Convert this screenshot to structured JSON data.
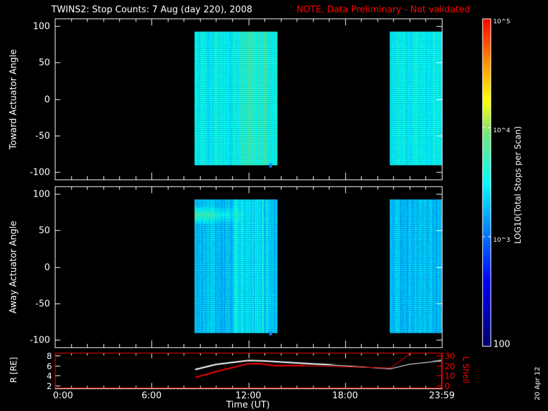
{
  "chart_data": {
    "type": "heatmap",
    "title": "TWINS2: Stop Counts:  7 Aug (day 220), 2008",
    "note": "NOTE. Data Preliminary - Not validated",
    "note_color": "#ff0000",
    "panels": [
      {
        "ylabel": "Toward Actuator Angle",
        "ylim": [
          -110,
          110
        ],
        "yticks": [
          "100",
          "50",
          "0",
          "-50",
          "-100"
        ],
        "ytick_values": [
          100,
          50,
          0,
          -50,
          -100
        ],
        "data_intervals_hours": [
          [
            8.67,
            13.8
          ],
          [
            20.77,
            24
          ]
        ],
        "angle_range": [
          -88,
          92
        ],
        "typical_log_counts": 3.5
      },
      {
        "ylabel": "Away Actuator Angle",
        "ylim": [
          -110,
          110
        ],
        "yticks": [
          "100",
          "50",
          "0",
          "-50",
          "-100"
        ],
        "ytick_values": [
          100,
          50,
          0,
          -50,
          -100
        ],
        "data_intervals_hours": [
          [
            8.67,
            13.8
          ],
          [
            20.77,
            24
          ]
        ],
        "angle_range": [
          -88,
          92
        ],
        "typical_log_counts": 3.3,
        "enhanced_band_angle": 72
      }
    ],
    "colorbar": {
      "label": "LOG10(Total Stops per Scan)",
      "range": [
        100,
        100000
      ],
      "ticks": [
        "100",
        "10^3",
        "10^4",
        "10^5"
      ]
    },
    "orbit_panel": {
      "ylabel_left": "R [RE]",
      "ylim_left": [
        1.5,
        8.5
      ],
      "yticks_left": [
        "2",
        "4",
        "6",
        "8"
      ],
      "ylabel_right": "L Shell",
      "ylim_right": [
        -3,
        33
      ],
      "yticks_right": [
        "0",
        "10",
        "20",
        "30"
      ],
      "series": [
        {
          "name": "R",
          "color": "#ffffff",
          "x": [
            8.7,
            10,
            12,
            13,
            16,
            18,
            20.8,
            22,
            24
          ],
          "y": [
            5.2,
            6.2,
            7,
            6.9,
            6.3,
            6,
            5.4,
            6.3,
            7
          ]
        },
        {
          "name": "L Shell",
          "color": "#ff0000",
          "x": [
            8.7,
            10,
            12,
            12.8,
            13.6,
            16,
            20.8,
            22
          ],
          "y": [
            8,
            14,
            22,
            22,
            20,
            20,
            18,
            32
          ]
        }
      ]
    },
    "xlabel": "Time (UT)",
    "xlim": [
      0,
      24
    ],
    "xticks": [
      "0:00",
      "6:00",
      "12:00",
      "18:00",
      "23:59"
    ],
    "xtick_values": [
      0,
      6,
      12,
      18,
      24
    ],
    "date_stamp": "20 Apr 12"
  }
}
